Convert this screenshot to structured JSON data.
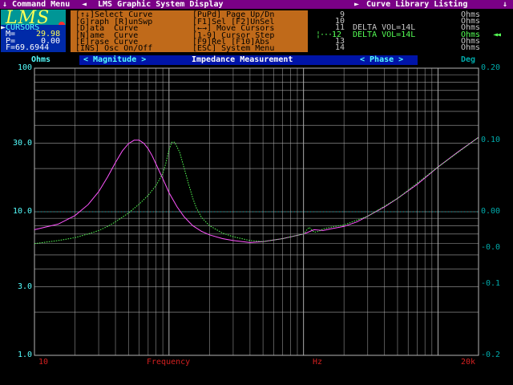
{
  "title_bar": {
    "left_arrow": "↓",
    "command_menu": "Command Menu",
    "sep1": "◄",
    "title": "LMS Graphic System Display",
    "sep2": "►",
    "curve_library": "Curve Library Listing",
    "right_arrow": "↓"
  },
  "logo": {
    "text": "LMS"
  },
  "cursors": {
    "title": "CURSORS",
    "m_label": "M=",
    "m_value": "29.98",
    "p_label": "P=",
    "p_value": "0.00",
    "f_label": "F=",
    "f_value": "69.6944"
  },
  "commands": [
    [
      "[↑↓]Select Curve",
      "[PuPd] Page Up/Dn"
    ],
    [
      "[G]raph [R]unSwp",
      "[F1]Sel [F2]UnSel"
    ],
    [
      "[D]ata  Curve",
      "[←→] Move Cursors"
    ],
    [
      "[N]ame  Curve",
      "[1-9] Cursor Step"
    ],
    [
      "[E]rase Curve",
      "[F9]Rel [F10]Abs"
    ],
    [
      "[INS] Osc On/Off",
      "[ESC] System Menu"
    ]
  ],
  "curve_list": [
    {
      "num": "9",
      "name": "",
      "unit": "Ohms",
      "selected": false
    },
    {
      "num": "10",
      "name": "",
      "unit": "Ohms",
      "selected": false
    },
    {
      "num": "11",
      "name": "DELTA VOL=14L",
      "unit": "Ohms",
      "selected": false
    },
    {
      "num": "12",
      "name": "DELTA VOL=14L",
      "unit": "Ohms",
      "selected": true
    },
    {
      "num": "13",
      "name": "",
      "unit": "Ohms",
      "selected": false
    },
    {
      "num": "14",
      "name": "",
      "unit": "Ohms",
      "selected": false
    }
  ],
  "header": {
    "left_unit": "Ohms",
    "magnitude": "< Magnitude >",
    "measurement": "Impedance Measurement",
    "phase": "< Phase >",
    "right_unit": "Deg"
  },
  "colors": {
    "magenta_curve": "#ff55ff",
    "green_curve": "#55ff55",
    "grid": "#b4b4b4",
    "left_axis": "#55ffff",
    "right_axis": "#00aaaa",
    "x_axis": "#d42020"
  },
  "chart_data": {
    "type": "line",
    "xlabel": "Frequency",
    "xunit": "Hz",
    "xscale": "log",
    "xlim": [
      10,
      20000
    ],
    "x_tick_labels": [
      "10",
      "Frequency",
      "Hz",
      "20k"
    ],
    "ylabel": "Ohms",
    "yscale": "log",
    "ylim": [
      1.0,
      100
    ],
    "y_tick_labels": [
      "100",
      "30.0",
      "10.0",
      "3.0",
      "1.0"
    ],
    "y2label": "Deg",
    "y2lim": [
      -0.2,
      0.2
    ],
    "y2_tick_labels": [
      "0.20",
      "0.10",
      "0.00",
      "-0.0",
      "-0.1",
      "-0.2"
    ],
    "grid": true,
    "cursor_frequency": 69.6944,
    "series": [
      {
        "color": "magenta",
        "x": [
          10,
          15,
          20,
          25,
          30,
          35,
          40,
          45,
          50,
          55,
          60,
          65,
          70,
          75,
          80,
          90,
          100,
          115,
          130,
          150,
          175,
          200,
          250,
          300,
          400,
          500,
          700,
          1000,
          1200,
          1400,
          1600,
          2000,
          2500,
          3000,
          4000,
          5000,
          7000,
          10000,
          14000,
          20000
        ],
        "y": [
          7.5,
          8.2,
          9.4,
          11.2,
          13.8,
          17.5,
          22.0,
          26.5,
          29.8,
          31.5,
          31.5,
          30.0,
          27.5,
          24.5,
          21.5,
          17.0,
          13.6,
          10.8,
          9.2,
          8.0,
          7.3,
          6.9,
          6.5,
          6.3,
          6.1,
          6.2,
          6.5,
          7.0,
          7.5,
          7.4,
          7.6,
          7.9,
          8.5,
          9.3,
          10.8,
          12.4,
          15.5,
          20.5,
          26.0,
          33.0
        ]
      },
      {
        "color": "green",
        "x": [
          10,
          15,
          20,
          25,
          30,
          35,
          40,
          50,
          60,
          70,
          80,
          90,
          95,
          100,
          105,
          110,
          120,
          130,
          140,
          150,
          160,
          175,
          200,
          250,
          300,
          400,
          500,
          700,
          1000,
          1100,
          1200,
          1300,
          1400,
          1600,
          2000,
          3000,
          5000,
          10000,
          20000
        ],
        "y": [
          6.0,
          6.3,
          6.6,
          7.0,
          7.4,
          7.9,
          8.5,
          9.8,
          11.3,
          13.0,
          15.2,
          18.5,
          22.0,
          27.0,
          30.5,
          30.5,
          26.0,
          20.0,
          15.5,
          12.5,
          10.6,
          9.1,
          8.0,
          7.1,
          6.7,
          6.3,
          6.2,
          6.5,
          7.0,
          7.8,
          7.2,
          7.3,
          7.6,
          7.8,
          8.1,
          9.3,
          12.4,
          20.5,
          33.0
        ]
      }
    ]
  }
}
